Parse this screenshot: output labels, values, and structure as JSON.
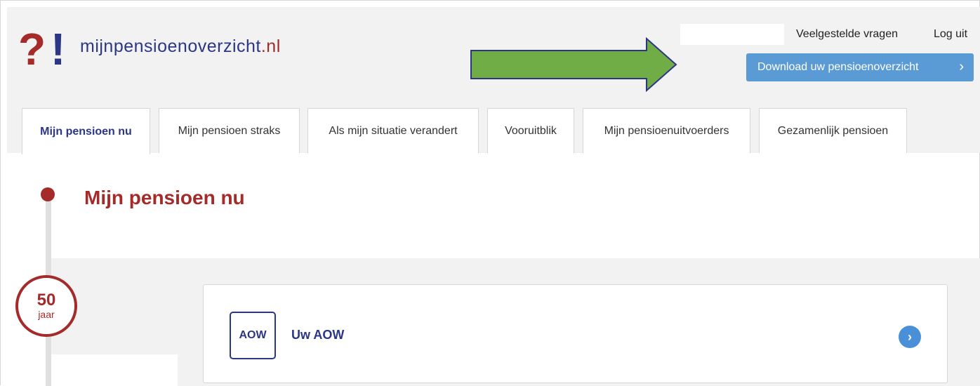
{
  "logo": {
    "question": "?",
    "exclamation": "!",
    "brand_main": "mijnpensioenoverzicht",
    "brand_tld": ".nl"
  },
  "header": {
    "faq_label": "Veelgestelde vragen",
    "logout_label": "Log uit",
    "download_label": "Download uw pensioenoverzicht",
    "download_chevron": "›"
  },
  "tabs": [
    {
      "label": "Mijn pensioen nu",
      "active": true
    },
    {
      "label": "Mijn pensioen straks",
      "active": false
    },
    {
      "label": "Als mijn situatie verandert",
      "active": false
    },
    {
      "label": "Vooruitblik",
      "active": false
    },
    {
      "label": "Mijn pensioenuitvoerders",
      "active": false
    },
    {
      "label": "Gezamenlijk pensioen",
      "active": false
    }
  ],
  "main": {
    "title": "Mijn pensioen nu",
    "age_number": "50",
    "age_unit": "jaar",
    "card": {
      "icon_text": "AOW",
      "title": "Uw AOW",
      "chevron": "›"
    }
  },
  "colors": {
    "brand_red": "#a52a2a",
    "brand_blue": "#2b3784",
    "button_blue": "#5b9bd5",
    "arrow_green": "#70ad47"
  }
}
